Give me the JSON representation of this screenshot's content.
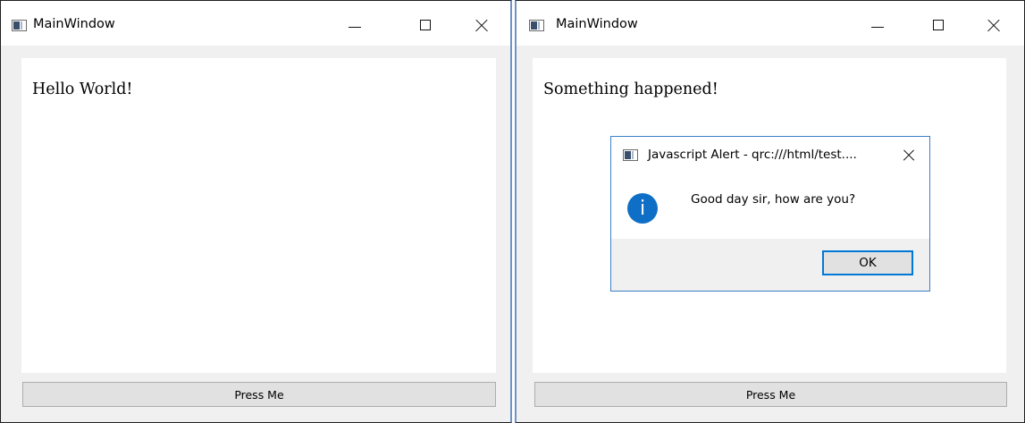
{
  "windows": [
    {
      "title": "MainWindow",
      "web_text": "Hello World!",
      "button_label": "Press Me"
    },
    {
      "title": "MainWindow",
      "web_text": "Something happened!",
      "button_label": "Press Me"
    }
  ],
  "dialog": {
    "title": "Javascript Alert - qrc:///html/test....",
    "message": "Good day sir, how are you?",
    "icon": "info-icon",
    "icon_glyph": "i",
    "ok_label": "OK"
  },
  "colors": {
    "accent": "#0078d7",
    "info_icon": "#0f6fc6",
    "window_border": "#6f93c7"
  }
}
